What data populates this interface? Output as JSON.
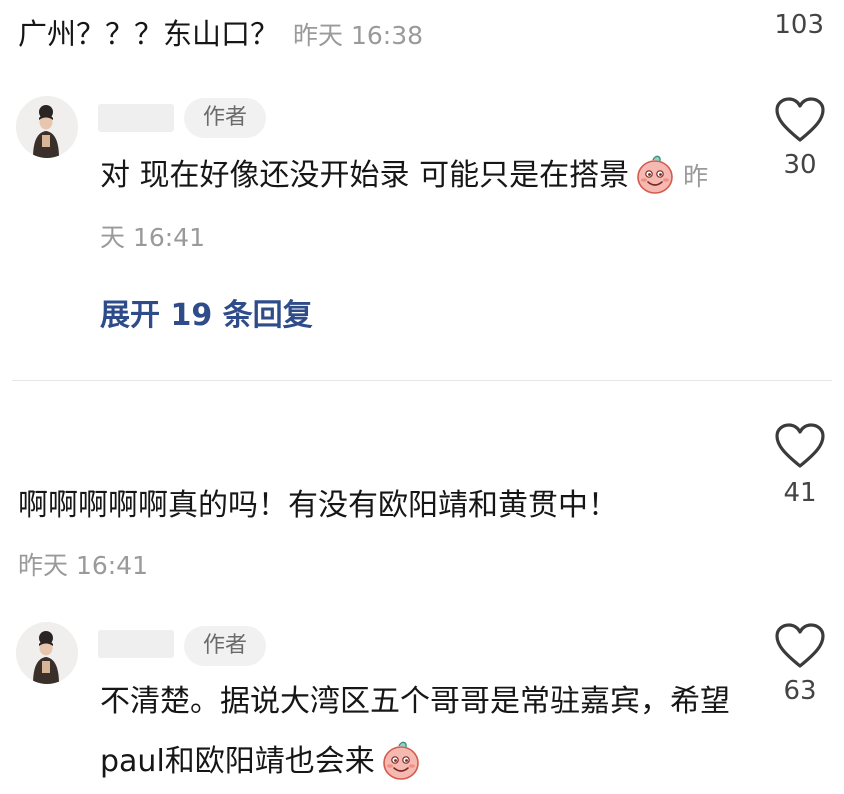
{
  "comment1": {
    "text": "广州？？？东山口？",
    "time": "昨天 16:38",
    "like_count": "103"
  },
  "reply1": {
    "author_tag": "作者",
    "text": "对 现在好像还没开始录 可能只是在搭景",
    "time": "昨天 16:41",
    "like_count": "30",
    "expand_label": "展开 19 条回复"
  },
  "comment2": {
    "text": "啊啊啊啊啊真的吗！有没有欧阳靖和黄贯中！",
    "time": "昨天 16:41",
    "like_count": "41"
  },
  "reply2": {
    "author_tag": "作者",
    "text": "不清楚。据说大湾区五个哥哥是常驻嘉宾，希望paul和欧阳靖也会来",
    "like_count": "63"
  },
  "icons": {
    "like": "heart-outline-icon",
    "emoji": "smiling-pink-face-emoji"
  },
  "colors": {
    "text": "#161616",
    "secondary": "#9a9a9a",
    "link": "#2f4c8a",
    "tag_bg": "#f1f1f1"
  }
}
